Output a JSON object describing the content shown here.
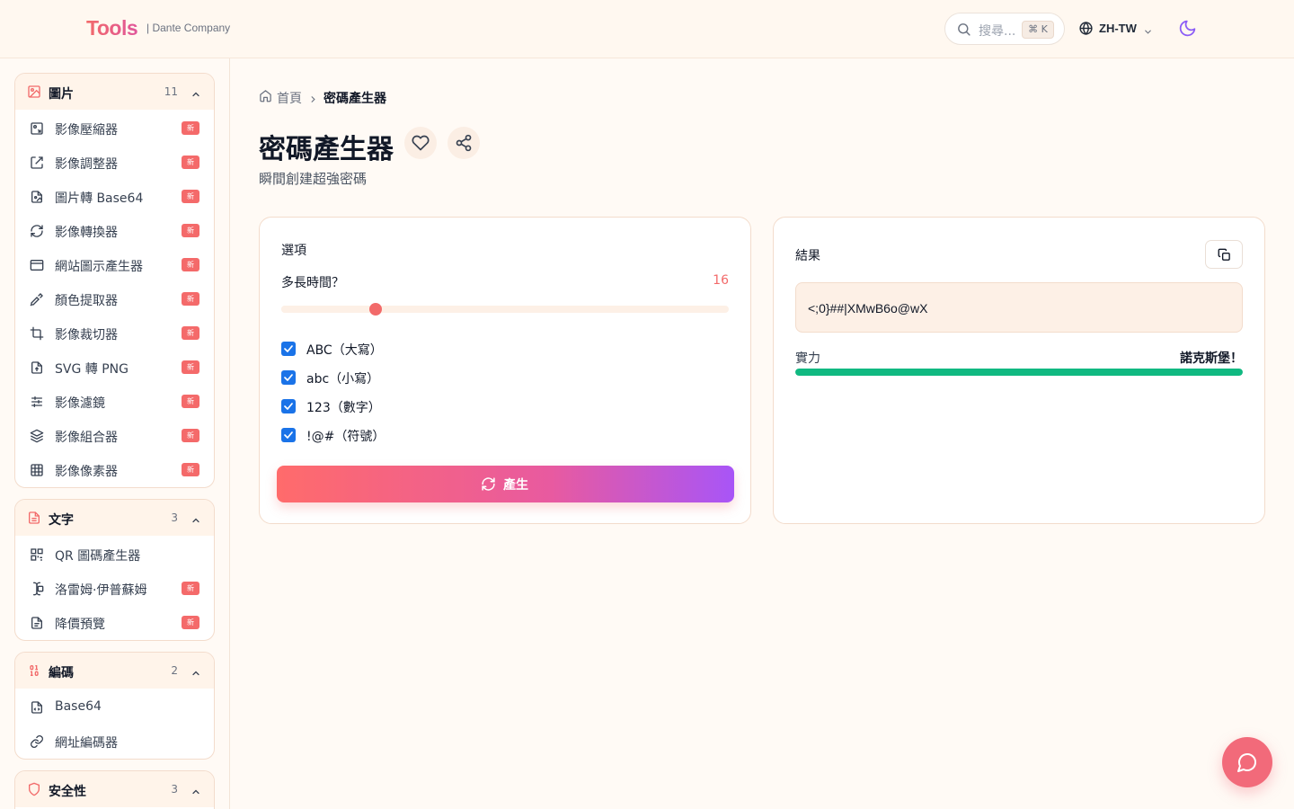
{
  "header": {
    "logo": "Tools",
    "company": "| Dante Company",
    "search_placeholder": "搜尋...",
    "search_shortcut": "⌘ K",
    "language": "ZH-TW"
  },
  "colors": {
    "accent": "#f26a6a",
    "badge": "#f46a6a",
    "strength": "#10b981",
    "checkbox": "#1a73e8"
  },
  "sidebar": {
    "groups": [
      {
        "title": "圖片",
        "count": "11",
        "icon": "image-icon",
        "items": [
          {
            "label": "影像壓縮器",
            "badge": "新",
            "icon": "image-compress-icon"
          },
          {
            "label": "影像調整器",
            "badge": "新",
            "icon": "resize-icon"
          },
          {
            "label": "圖片轉 Base64",
            "badge": "新",
            "icon": "file-image-icon"
          },
          {
            "label": "影像轉換器",
            "badge": "新",
            "icon": "refresh-icon"
          },
          {
            "label": "網站圖示產生器",
            "badge": "新",
            "icon": "browser-icon"
          },
          {
            "label": "顏色提取器",
            "badge": "新",
            "icon": "eyedropper-icon"
          },
          {
            "label": "影像裁切器",
            "badge": "新",
            "icon": "crop-icon"
          },
          {
            "label": "SVG 轉 PNG",
            "badge": "新",
            "icon": "file-code-icon"
          },
          {
            "label": "影像濾鏡",
            "badge": "新",
            "icon": "sliders-icon"
          },
          {
            "label": "影像組合器",
            "badge": "新",
            "icon": "layers-icon"
          },
          {
            "label": "影像像素器",
            "badge": "新",
            "icon": "grid-icon"
          }
        ]
      },
      {
        "title": "文字",
        "count": "3",
        "icon": "file-text-icon",
        "items": [
          {
            "label": "QR 圖碼產生器",
            "badge": "",
            "icon": "qr-code-icon"
          },
          {
            "label": "洛雷姆·伊普蘇姆",
            "badge": "新",
            "icon": "text-cursor-icon"
          },
          {
            "label": "降價預覽",
            "badge": "新",
            "icon": "document-icon"
          }
        ]
      },
      {
        "title": "編碼",
        "count": "2",
        "icon": "binary-icon",
        "items": [
          {
            "label": "Base64",
            "badge": "",
            "icon": "file-code-icon"
          },
          {
            "label": "網址編碼器",
            "badge": "",
            "icon": "link-icon"
          }
        ]
      },
      {
        "title": "安全性",
        "count": "3",
        "icon": "shield-icon",
        "items": []
      }
    ]
  },
  "breadcrumb": {
    "home": "首頁",
    "current": "密碼產生器"
  },
  "page": {
    "title": "密碼產生器",
    "subtitle": "瞬間創建超強密碼"
  },
  "options": {
    "title": "選項",
    "length_label": "多長時間？",
    "length_value": "16",
    "length_fraction": 0.21,
    "checkboxes": [
      {
        "label": "ABC（大寫）",
        "checked": true
      },
      {
        "label": "abc（小寫）",
        "checked": true
      },
      {
        "label": "123（數字）",
        "checked": true
      },
      {
        "label": "!@#（符號）",
        "checked": true
      }
    ],
    "generate_label": "產生"
  },
  "result": {
    "title": "結果",
    "password": "<;0}##|XMwB6o@wX",
    "strength_label": "實力",
    "strength_value": "諾克斯堡！",
    "strength_fraction": 1.0
  }
}
